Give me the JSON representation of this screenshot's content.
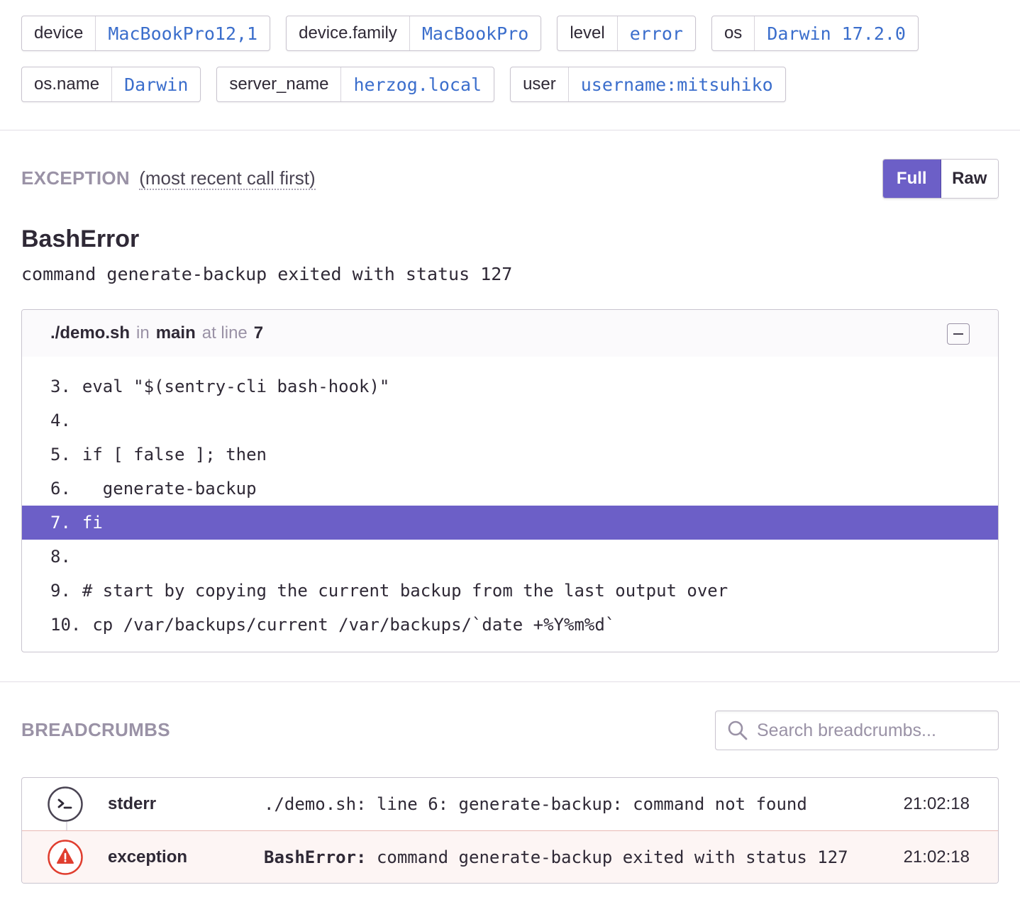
{
  "tags": [
    [
      {
        "key": "device",
        "value": "MacBookPro12,1"
      },
      {
        "key": "device.family",
        "value": "MacBookPro"
      },
      {
        "key": "level",
        "value": "error"
      },
      {
        "key": "os",
        "value": "Darwin 17.2.0"
      }
    ],
    [
      {
        "key": "os.name",
        "value": "Darwin"
      },
      {
        "key": "server_name",
        "value": "herzog.local"
      },
      {
        "key": "user",
        "value": "username:mitsuhiko"
      }
    ]
  ],
  "exception": {
    "heading": "EXCEPTION",
    "subheading": "(most recent call first)",
    "toggle": {
      "full": "Full",
      "raw": "Raw",
      "selected": "Full"
    },
    "type": "BashError",
    "value": "command generate-backup exited with status 127",
    "frame": {
      "file": "./demo.sh",
      "in_label": "in",
      "function": "main",
      "at_line_label": "at line",
      "line": "7",
      "lines": [
        {
          "no": "3.",
          "code": "eval \"$(sentry-cli bash-hook)\"",
          "active": false
        },
        {
          "no": "4.",
          "code": "",
          "active": false
        },
        {
          "no": "5.",
          "code": "if [ false ]; then",
          "active": false
        },
        {
          "no": "6.",
          "code": "  generate-backup",
          "active": false
        },
        {
          "no": "7.",
          "code": "fi",
          "active": true
        },
        {
          "no": "8.",
          "code": "",
          "active": false
        },
        {
          "no": "9.",
          "code": "# start by copying the current backup from the last output over",
          "active": false
        },
        {
          "no": "10.",
          "code": "cp /var/backups/current /var/backups/`date +%Y%m%d`",
          "active": false
        }
      ]
    }
  },
  "breadcrumbs": {
    "heading": "BREADCRUMBS",
    "search_placeholder": "Search breadcrumbs...",
    "items": [
      {
        "icon": "terminal-icon",
        "type": "stderr",
        "message_prefix": "",
        "message": "./demo.sh: line 6: generate-backup: command not found",
        "time": "21:02:18"
      },
      {
        "icon": "warning-icon",
        "type": "exception",
        "message_prefix": "BashError:",
        "message": " command generate-backup exited with status 127",
        "time": "21:02:18"
      }
    ]
  },
  "colors": {
    "accent": "#6c5fc7",
    "link": "#3b6ecc",
    "error": "#e03e2f",
    "muted": "#9a92a6"
  }
}
